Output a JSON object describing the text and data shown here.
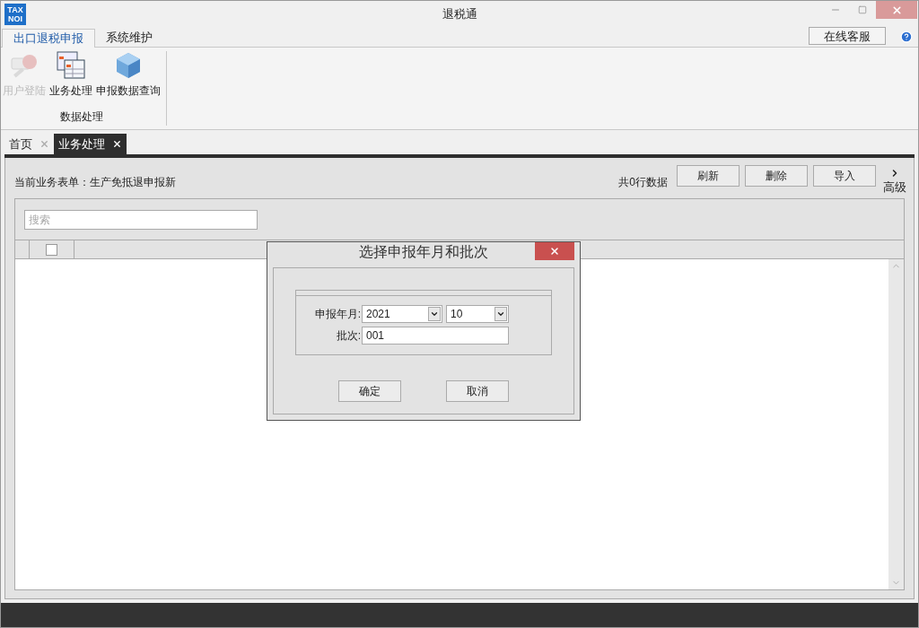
{
  "window": {
    "title": "退税通",
    "logo": [
      "TAX",
      "NOI"
    ]
  },
  "ribbon": {
    "tabs": [
      {
        "label": "出口退税申报",
        "selected": true
      },
      {
        "label": "系统维护",
        "selected": false
      }
    ],
    "online_service": "在线客服",
    "group": {
      "label": "数据处理",
      "items": [
        {
          "label": "用户登陆",
          "kind": "key",
          "disabled": true
        },
        {
          "label": "业务处理",
          "kind": "table",
          "disabled": false
        },
        {
          "label": "申报数据查询",
          "kind": "cube",
          "disabled": false
        }
      ]
    }
  },
  "doc_tabs": [
    {
      "label": "首页",
      "selected": false
    },
    {
      "label": "业务处理",
      "selected": true
    }
  ],
  "toolbar": {
    "current_form": "当前业务表单：生产免抵退申报新",
    "row_count": "共0行数据",
    "buttons": [
      "刷新",
      "删除",
      "导入"
    ],
    "advanced": "高级"
  },
  "grid": {
    "search": {
      "placeholder": "搜索"
    },
    "select_all": {
      "checked": false
    }
  },
  "dialog": {
    "title": "选择申报年月和批次",
    "year_month_label": "申报年月:",
    "year": "2021",
    "month": "10",
    "batch_label": "批次:",
    "batch": "001",
    "buttons": [
      "确定",
      "取消"
    ]
  }
}
